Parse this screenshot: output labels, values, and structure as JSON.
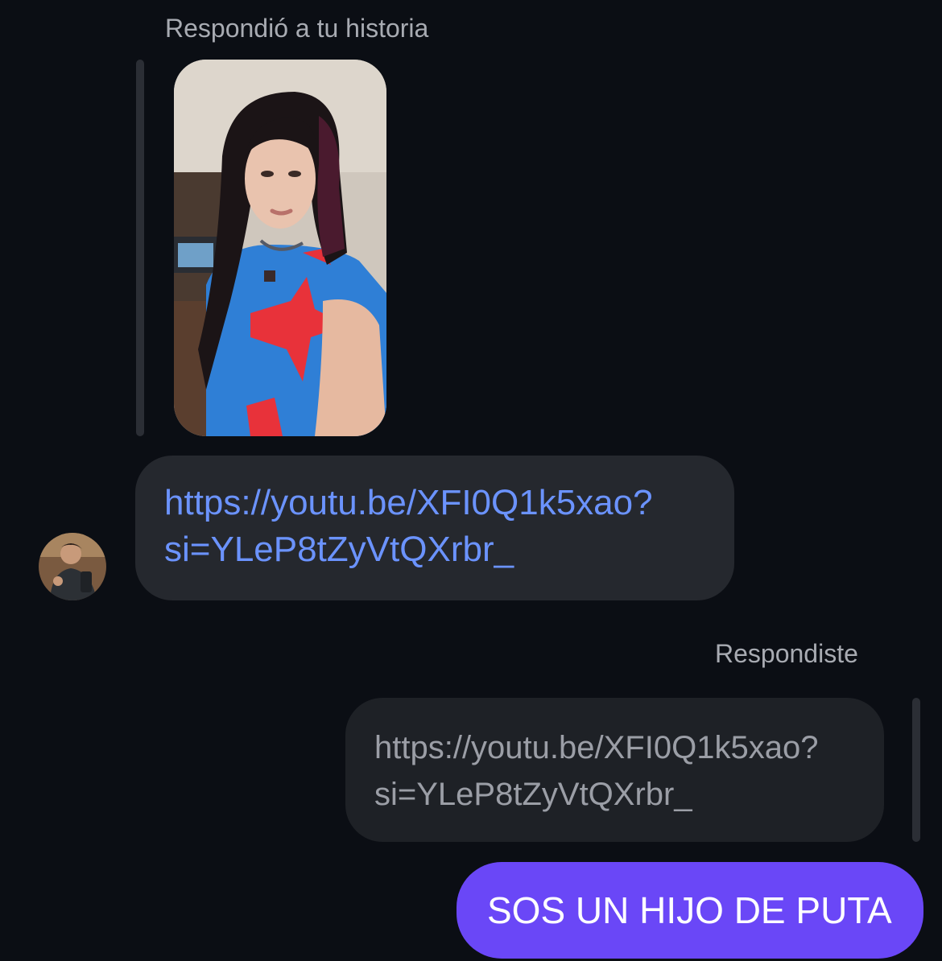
{
  "thread": {
    "story_reply_caption": "Respondió a tu historia",
    "incoming_message": {
      "text": "https://youtu.be/XFI0Q1k5xao?si=YLeP8tZyVtQXrbr_",
      "line1": "https://youtu.be/XFI0Q1k5xao?",
      "line2": "si=YLeP8tZyVtQXrbr_"
    },
    "you_replied_caption": "Respondiste",
    "quoted_message": {
      "line1": "https://youtu.be/XFI0Q1k5xao?",
      "line2": "si=YLeP8tZyVtQXrbr_"
    },
    "outgoing_message": "SOS UN HIJO DE PUTA"
  },
  "icons": {
    "story": "story-photo",
    "sender": "sender-avatar"
  },
  "colors": {
    "background": "#0b0e14",
    "incoming_bubble": "#25282e",
    "quoted_bubble": "#1e2126",
    "outgoing_bubble": "#6a47f7",
    "link": "#6b93ff",
    "caption": "#a8abb2"
  }
}
